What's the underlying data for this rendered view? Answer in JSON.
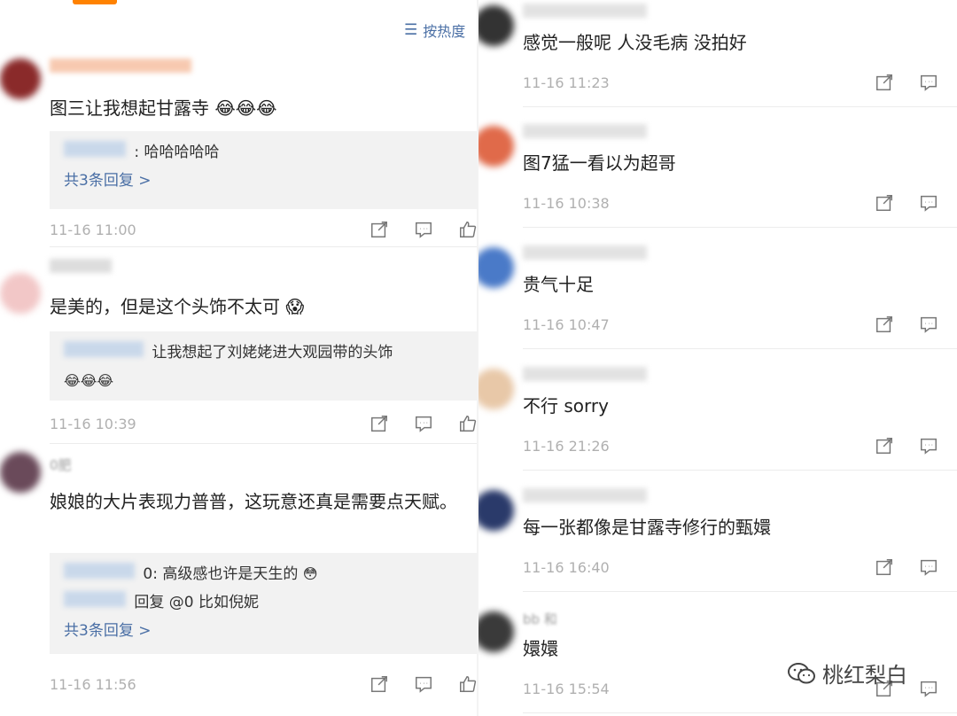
{
  "sort": {
    "label": "按热度"
  },
  "left_comments": [
    {
      "content": "图三让我想起甘露寺",
      "emoji": "😂😂😂",
      "replies": [
        {
          "text": ": 哈哈哈哈哈"
        }
      ],
      "more_replies": "共3条回复 >",
      "timestamp": "11-16 11:00",
      "avatar_color": "#8a2a2a"
    },
    {
      "content": "是美的，但是这个头饰不太可",
      "emoji": "😱",
      "replies": [
        {
          "text": "让我想起了刘姥姥进大观园带的头饰"
        }
      ],
      "reply_emoji": "😂😂😂",
      "timestamp": "11-16 10:39",
      "avatar_color": "#f2c7c7"
    },
    {
      "username": "0肥",
      "content": "娘娘的大片表现力普普，这玩意还真是需要点天赋。",
      "replies": [
        {
          "text": "0: 高级感也许是天生的"
        },
        {
          "text": "回复 @0        比如倪妮"
        }
      ],
      "reply_emoji": "😳",
      "more_replies": "共3条回复 >",
      "timestamp": "11-16 11:56",
      "avatar_color": "#6a4a5a"
    }
  ],
  "right_comments": [
    {
      "content": "感觉一般呢 人没毛病 没拍好",
      "timestamp": "11-16 11:23",
      "avatar_color": "#333333"
    },
    {
      "content": "图7猛一看以为超哥",
      "timestamp": "11-16 10:38",
      "avatar_color": "#e06a4a"
    },
    {
      "content": "贵气十足",
      "timestamp": "11-16 10:47",
      "avatar_color": "#4a7ac8"
    },
    {
      "content": "不行 sorry",
      "timestamp": "11-16 21:26",
      "avatar_color": "#e8c8a8"
    },
    {
      "content": "每一张都像是甘露寺修行的甄嬛",
      "timestamp": "11-16 16:40",
      "avatar_color": "#2a3a6a"
    },
    {
      "username": "bb 和",
      "content": "嬛嬛",
      "timestamp": "11-16 15:54",
      "avatar_color": "#3a3a3a"
    }
  ],
  "watermark": {
    "text": "桃红梨白"
  },
  "icons": {
    "share": "share-icon",
    "comment": "comment-icon",
    "like": "like-icon",
    "sort": "sort-icon"
  }
}
